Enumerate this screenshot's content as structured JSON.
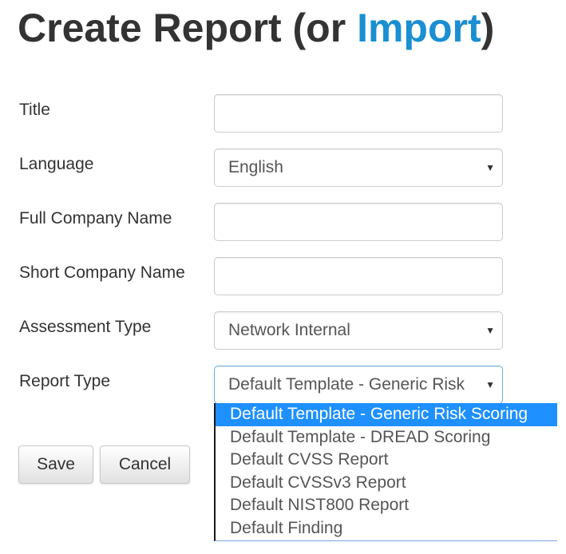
{
  "page": {
    "title_prefix": "Create Report (or ",
    "title_link": "Import",
    "title_suffix": ")"
  },
  "form": {
    "title": {
      "label": "Title",
      "value": ""
    },
    "language": {
      "label": "Language",
      "value": "English"
    },
    "full_company_name": {
      "label": "Full Company Name",
      "value": ""
    },
    "short_company_name": {
      "label": "Short Company Name",
      "value": ""
    },
    "assessment_type": {
      "label": "Assessment Type",
      "value": "Network Internal"
    },
    "report_type": {
      "label": "Report Type",
      "value": "Default Template - Generic Risk Scoring",
      "options": [
        "Default Template - Generic Risk Scoring",
        "Default Template - DREAD Scoring",
        "Default CVSS Report",
        "Default CVSSv3 Report",
        "Default NIST800 Report",
        "Default Finding"
      ],
      "selected_index": 0
    }
  },
  "buttons": {
    "save": "Save",
    "cancel": "Cancel"
  },
  "colors": {
    "link": "#1a8fd1",
    "option_highlight": "#1e90ff",
    "text": "#333333"
  },
  "icons": {
    "select_caret": "▼"
  }
}
